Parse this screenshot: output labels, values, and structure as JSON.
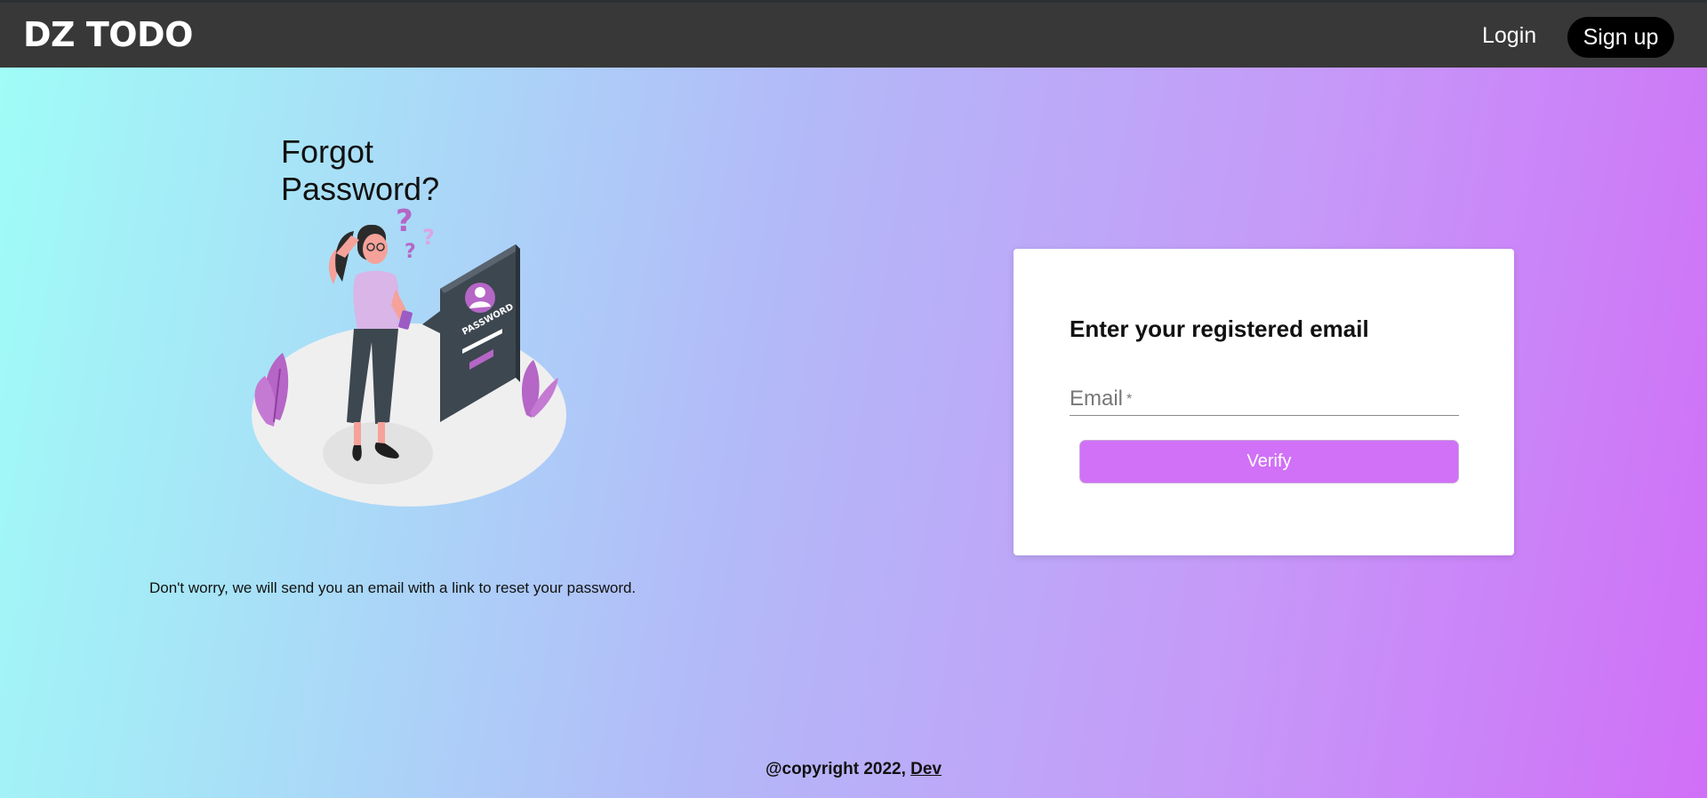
{
  "navbar": {
    "brand": "DZ TODO",
    "login_label": "Login",
    "signup_label": "Sign up"
  },
  "main": {
    "title": "Forgot Password?",
    "subtext": "Don't worry, we will send you an email with a link to reset your password.",
    "illustration": {
      "icon": "forgot-password-illustration",
      "sign_text": "PASSWORD"
    }
  },
  "form": {
    "heading": "Enter your registered email",
    "email_label": "Email",
    "email_required_mark": "*",
    "email_value": "",
    "verify_label": "Verify"
  },
  "footer": {
    "copyright": "@copyright 2022, ",
    "link_label": "Dev"
  },
  "colors": {
    "navbar_bg": "#383838",
    "accent": "#d071f7",
    "gradient_start": "#9ffdf7",
    "gradient_end": "#d06ff7"
  }
}
